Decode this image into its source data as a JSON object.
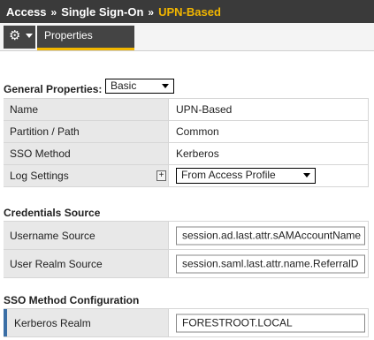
{
  "breadcrumb": {
    "items": [
      "Access",
      "Single Sign-On",
      "UPN-Based"
    ],
    "separator": "»"
  },
  "toolbar": {
    "gear_icon": "gear-icon",
    "tab_label": "Properties"
  },
  "general": {
    "title": "General Properties:",
    "view_select": "Basic",
    "rows": [
      {
        "label": "Name",
        "value": "UPN-Based"
      },
      {
        "label": "Partition / Path",
        "value": "Common"
      },
      {
        "label": "SSO Method",
        "value": "Kerberos"
      },
      {
        "label": "Log Settings",
        "value": "From Access Profile"
      }
    ],
    "plus_label": "+"
  },
  "credentials": {
    "title": "Credentials Source",
    "rows": [
      {
        "label": "Username Source",
        "value": "session.ad.last.attr.sAMAccountName"
      },
      {
        "label": "User Realm Source",
        "value": "session.saml.last.attr.name.ReferralD"
      }
    ]
  },
  "sso_config": {
    "title": "SSO Method Configuration",
    "rows": [
      {
        "label": "Kerberos Realm",
        "value": "FORESTROOT.LOCAL"
      }
    ]
  },
  "colors": {
    "header_bg": "#3a3a3a",
    "accent": "#f2b600",
    "required": "#3a6ea5"
  }
}
